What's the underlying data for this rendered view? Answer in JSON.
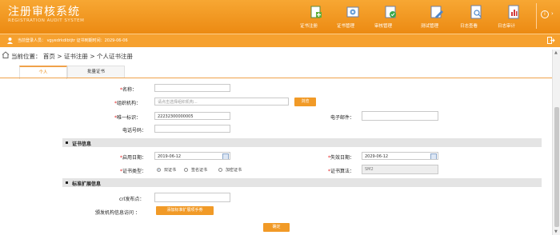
{
  "header": {
    "title_cn": "注册审核系统",
    "title_en": "REGISTRATION AUDIT SYSTEM",
    "nav": [
      {
        "label": "证书注册",
        "icon": "certificate-register-icon"
      },
      {
        "label": "证书管理",
        "icon": "certificate-manage-icon"
      },
      {
        "label": "审核管理",
        "icon": "audit-manage-icon"
      },
      {
        "label": "测试管理",
        "icon": "test-manage-icon"
      },
      {
        "label": "日志查看",
        "icon": "log-view-icon"
      },
      {
        "label": "日志审计",
        "icon": "log-audit-icon"
      }
    ]
  },
  "userbar": {
    "text": "当前登录人员： vgyedrkdibtjtr   证书到期时间：2029-06-06"
  },
  "breadcrumb": {
    "text": "当前位置：   首页  >  证书注册  >  个人证书注册"
  },
  "tabs": [
    {
      "label": "个人",
      "active": true
    },
    {
      "label": "批量证书",
      "active": false
    }
  ],
  "form": {
    "name_label": "名称：",
    "org_label": "组织机构：",
    "org_placeholder": "请点击选择组织机构...",
    "browse_button": "浏览",
    "uid_label": "唯一标识：",
    "uid_value": "22232300000005",
    "email_label": "电子邮件：",
    "phone_label": "电话号码：",
    "section_cert": "证书信息",
    "start_label": "启用日期：",
    "start_value": "2019-06-12",
    "end_label": "失效日期：",
    "end_value": "2029-06-12",
    "type_label": "证书类型：",
    "type_options": [
      "双证书",
      "签名证书",
      "加密证书"
    ],
    "algo_label": "证书算法：",
    "algo_value": "SM2",
    "section_ext": "标准扩展信息",
    "crl_label": "crl发布点：",
    "issuer_label": "颁发机构信息访问 ：",
    "add_ext_button": "添加标准扩展项手券",
    "submit_button": "确定"
  },
  "colors": {
    "header_orange": "#f29a26",
    "accent": "#f19a27",
    "required": "#e02020"
  }
}
